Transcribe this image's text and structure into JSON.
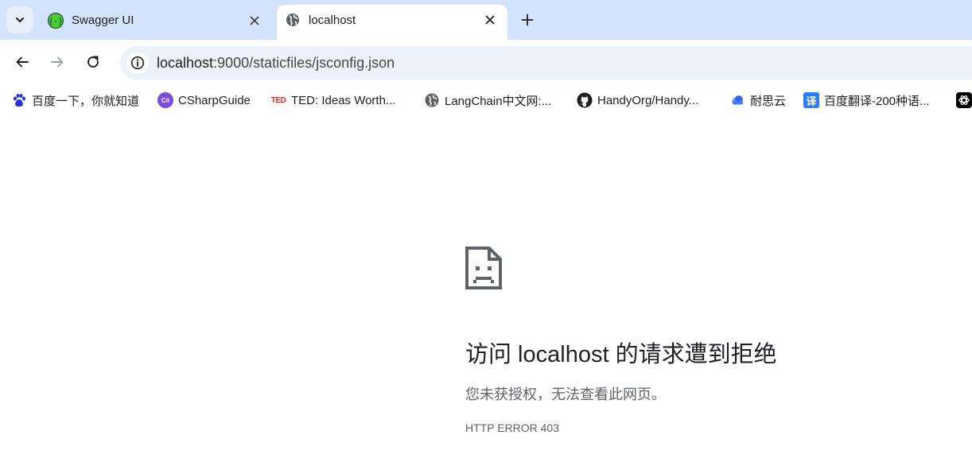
{
  "tabs": [
    {
      "title": "Swagger UI",
      "favicon": "swagger-icon",
      "active": false
    },
    {
      "title": "localhost",
      "favicon": "globe-icon",
      "active": true
    }
  ],
  "toolbar": {
    "url_host": "localhost",
    "url_rest": ":9000/staticfiles/jsconfig.json"
  },
  "bookmarks": [
    {
      "label": "百度一下，你就知道",
      "icon": "baidu-paw-icon"
    },
    {
      "label": "CSharpGuide",
      "icon": "csharp-icon"
    },
    {
      "label": "TED: Ideas Worth...",
      "icon": "ted-icon"
    },
    {
      "label": "LangChain中文网:...",
      "icon": "globe-icon"
    },
    {
      "label": "HandyOrg/Handy...",
      "icon": "github-icon"
    },
    {
      "label": "耐思云",
      "icon": "cloud-icon"
    },
    {
      "label": "百度翻译-200种语...",
      "icon": "translate-icon"
    },
    {
      "label": "",
      "icon": "openai-icon"
    }
  ],
  "error": {
    "icon": "sad-document-icon",
    "title": "访问 localhost 的请求遭到拒绝",
    "description": "您未获授权，无法查看此网页。",
    "code": "HTTP ERROR 403"
  },
  "colors": {
    "tab_strip": "#d3e3fd",
    "omnibox": "#edf2fa",
    "text": "#1f1f1f",
    "muted": "#5f6368"
  },
  "icon_text": {
    "ted": "TED",
    "translate": "译",
    "csharp": "C#"
  }
}
